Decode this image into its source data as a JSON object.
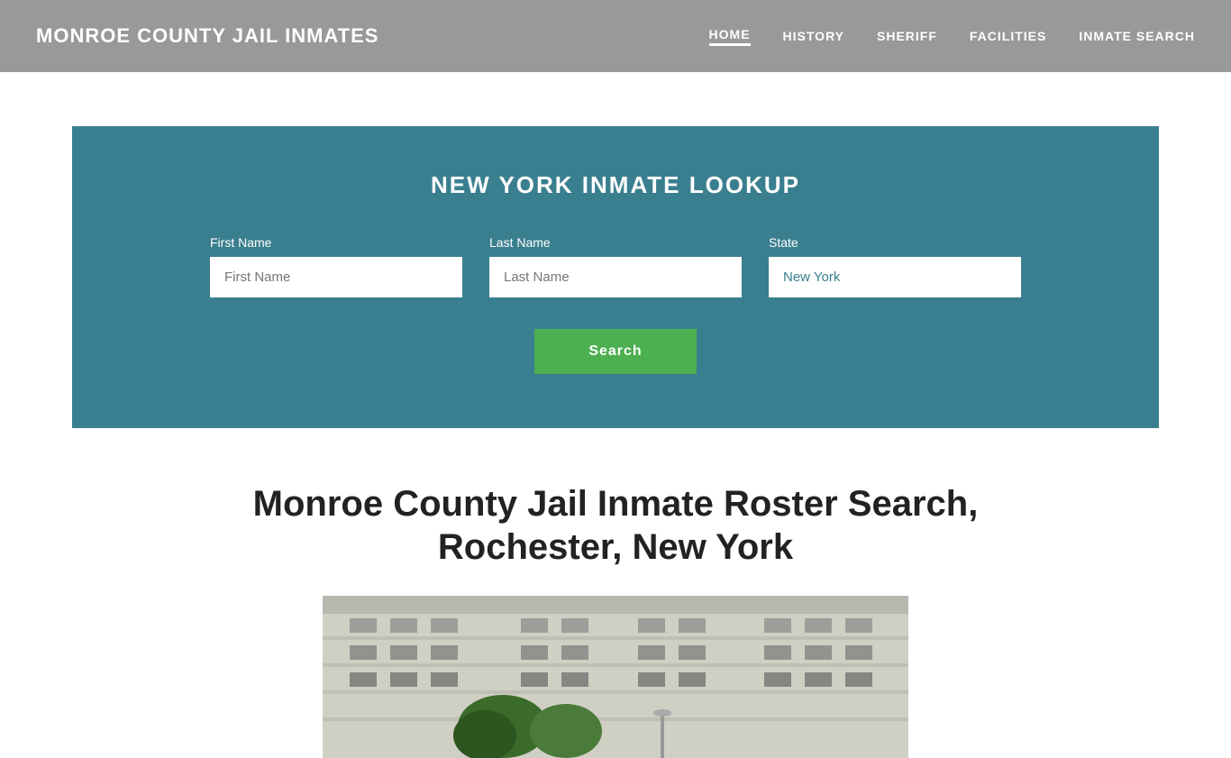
{
  "header": {
    "site_title": "MONROE COUNTY JAIL INMATES",
    "nav": {
      "items": [
        {
          "label": "HOME",
          "active": true
        },
        {
          "label": "HISTORY",
          "active": false
        },
        {
          "label": "SHERIFF",
          "active": false
        },
        {
          "label": "FACILITIES",
          "active": false
        },
        {
          "label": "INMATE SEARCH",
          "active": false
        }
      ]
    }
  },
  "search": {
    "title": "NEW YORK INMATE LOOKUP",
    "fields": {
      "first_name_label": "First Name",
      "first_name_placeholder": "First Name",
      "last_name_label": "Last Name",
      "last_name_placeholder": "Last Name",
      "state_label": "State",
      "state_value": "New York"
    },
    "button_label": "Search"
  },
  "content": {
    "title": "Monroe County Jail Inmate Roster Search, Rochester, New York"
  }
}
